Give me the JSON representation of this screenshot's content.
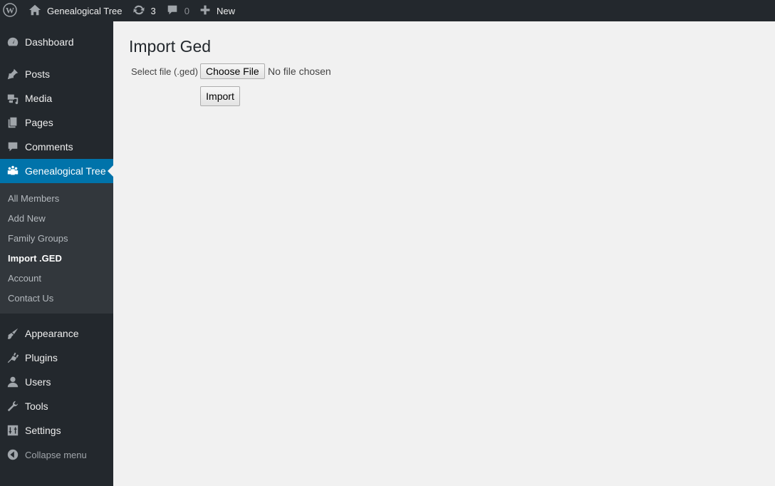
{
  "adminbar": {
    "logo_icon": "wordpress-logo-icon",
    "site_icon": "home-icon",
    "site_name": "Genealogical Tree",
    "updates_icon": "updates-icon",
    "updates_count": "3",
    "comments_icon": "comment-bubble-icon",
    "comments_count": "0",
    "new_icon": "plus-icon",
    "new_label": "New"
  },
  "sidebar": {
    "items": [
      {
        "label": "Dashboard",
        "icon": "dashboard-icon"
      },
      {
        "label": "Posts",
        "icon": "pin-icon"
      },
      {
        "label": "Media",
        "icon": "media-icon"
      },
      {
        "label": "Pages",
        "icon": "pages-icon"
      },
      {
        "label": "Comments",
        "icon": "comment-icon"
      },
      {
        "label": "Genealogical Tree",
        "icon": "family-icon",
        "current": true
      },
      {
        "label": "Appearance",
        "icon": "brush-icon"
      },
      {
        "label": "Plugins",
        "icon": "plug-icon"
      },
      {
        "label": "Users",
        "icon": "user-icon"
      },
      {
        "label": "Tools",
        "icon": "wrench-icon"
      },
      {
        "label": "Settings",
        "icon": "settings-icon"
      }
    ],
    "submenu": [
      {
        "label": "All Members"
      },
      {
        "label": "Add New"
      },
      {
        "label": "Family Groups"
      },
      {
        "label": "Import .GED",
        "active": true
      },
      {
        "label": "Account"
      },
      {
        "label": "Contact Us"
      }
    ],
    "collapse_label": "Collapse menu"
  },
  "main": {
    "title": "Import Ged",
    "file_label": "Select file (.ged)",
    "choose_file_label": "Choose File",
    "file_status": "No file chosen",
    "import_label": "Import"
  }
}
